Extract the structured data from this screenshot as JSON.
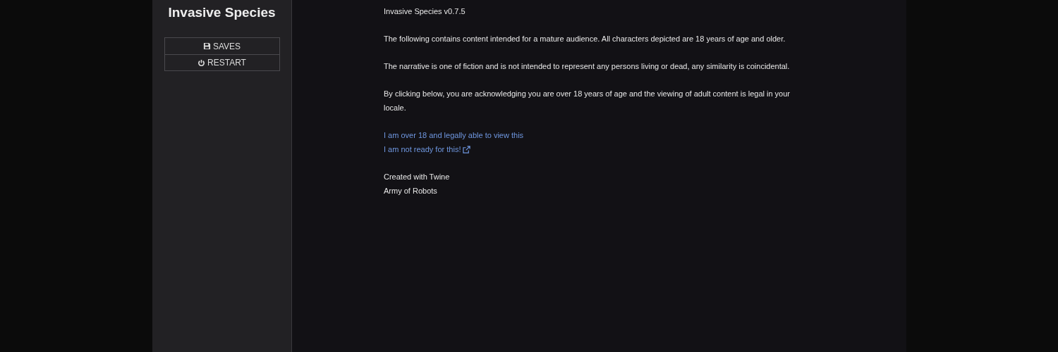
{
  "sidebar": {
    "title": "Invasive Species",
    "menu": [
      {
        "kind": "save",
        "label": "SAVES"
      },
      {
        "kind": "restart",
        "label": "RESTART"
      }
    ]
  },
  "passage": {
    "version": "Invasive Species v0.7.5",
    "paragraphs": [
      "The following contains content intended for a mature audience. All characters depicted are 18 years of age and older.",
      "The narrative is one of fiction and is not intended to represent any persons living or dead, any similarity is coincidental.",
      "By clicking below, you are acknowledging you are over 18 years of age and the viewing of adult content is legal in your locale."
    ],
    "links": [
      {
        "text": "I am over 18 and legally able to view this",
        "external": false
      },
      {
        "text": "I am not ready for this!",
        "external": true
      }
    ],
    "credits": [
      "Created with Twine",
      "Army of Robots"
    ]
  }
}
